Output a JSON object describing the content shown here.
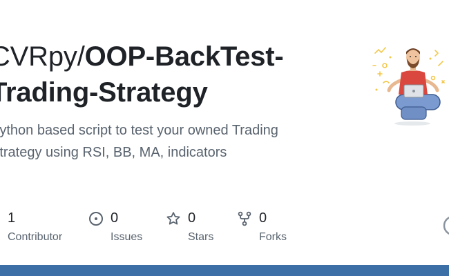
{
  "repo": {
    "owner": "CVRpy/",
    "name_line1": "OOP-BackTest-",
    "name_line2": "Trading-Strategy",
    "description": "Python based script to test your owned Trading Strategy using RSI, BB, MA, indicators"
  },
  "stats": {
    "contributors": {
      "count": "1",
      "label": "Contributor"
    },
    "issues": {
      "count": "0",
      "label": "Issues",
      "icon": "issue-opened-icon"
    },
    "stars": {
      "count": "0",
      "label": "Stars",
      "icon": "star-icon"
    },
    "forks": {
      "count": "0",
      "label": "Forks",
      "icon": "repo-forked-icon"
    }
  },
  "colors": {
    "title": "#1f2328",
    "muted": "#59636e",
    "bottom_bar": "#3b6fa5",
    "icon": "#59636e"
  }
}
